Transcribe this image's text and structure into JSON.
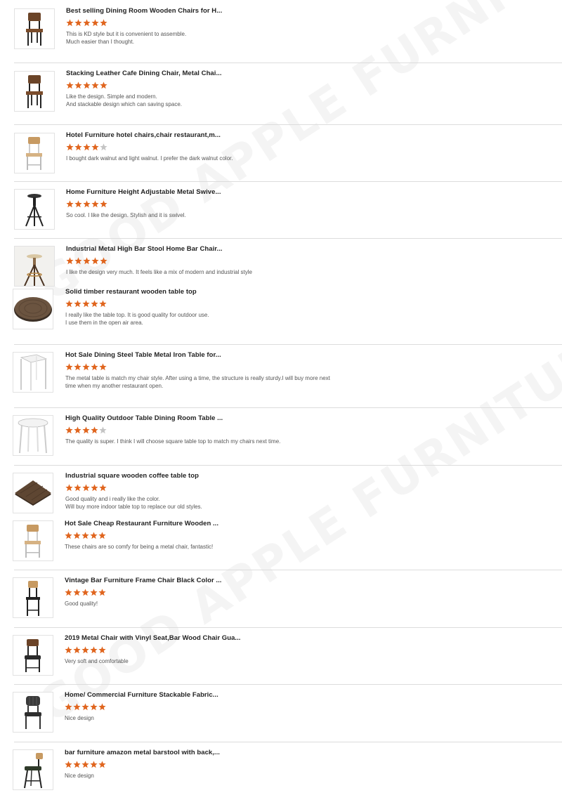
{
  "watermark": "GOOD APPLE FURNITURE",
  "colors": {
    "star_on": "#e0651e",
    "star_off": "#c4c4c4",
    "separator": "#dcdcdc"
  },
  "reviews": [
    {
      "title": "Best selling Dining Room Wooden Chairs for H...",
      "rating": 5,
      "comment": [
        "This is KD style but it is convenient to assemble.",
        "Much easier than I thought."
      ],
      "image": "chair-dark-wood-icon"
    },
    {
      "title": "Stacking Leather Cafe Dining Chair, Metal Chai...",
      "rating": 5,
      "comment": [
        "Like the design. Simple and modern.",
        "And stackable design which can saving space."
      ],
      "image": "chair-dark-wood-icon"
    },
    {
      "title": "Hotel Furniture hotel chairs,chair restaurant,m...",
      "rating": 4,
      "comment": [
        "I bought dark walnut and light walnut. I prefer the dark walnut color."
      ],
      "image": "chair-light-wood-icon"
    },
    {
      "title": "Home Furniture Height Adjustable Metal Swive...",
      "rating": 5,
      "comment": [
        "So cool. I like the design. Stylish and it is swivel."
      ],
      "image": "swivel-stool-icon"
    },
    {
      "title": "Industrial Metal High Bar Stool Home Bar Chair...",
      "rating": 5,
      "comment": [
        "I like the design very much. It feels like a mix of modern and industrial style"
      ],
      "image": "bar-stool-icon"
    },
    {
      "title": "Solid timber restaurant wooden table top",
      "rating": 5,
      "comment": [
        "I really like the table top. It is good quality for outdoor use.",
        "I use them in the open air area."
      ],
      "image": "round-table-top-icon"
    },
    {
      "title": "Hot Sale Dining Steel Table Metal Iron Table for...",
      "rating": 5,
      "comment": [
        "The metal table is match my chair style. After using a time, the structure is really sturdy.I will buy more next",
        "time when my another restaurant open."
      ],
      "image": "square-metal-table-icon"
    },
    {
      "title": "High Quality Outdoor Table Dining Room Table ...",
      "rating": 4,
      "comment": [
        "The quality is super. I think I will choose square table top to match my chairs next time."
      ],
      "image": "round-metal-table-icon"
    },
    {
      "title": "Industrial square wooden coffee table top",
      "rating": 5,
      "comment": [
        "Good quality and i really like the color.",
        "Will buy more indoor table top to replace our old styles."
      ],
      "image": "square-table-top-icon"
    },
    {
      "title": "Hot Sale Cheap Restaurant Furniture Wooden ...",
      "rating": 5,
      "comment": [
        "These chairs are so comfy for being a metal chair, fantastic!"
      ],
      "image": "chair-light-wood-icon"
    },
    {
      "title": "Vintage Bar Furniture Frame Chair Black Color ...",
      "rating": 5,
      "comment": [
        "Good quality!"
      ],
      "image": "bar-chair-icon"
    },
    {
      "title": "2019 Metal Chair with Vinyl Seat,Bar Wood Chair Gua...",
      "rating": 5,
      "comment": [
        "Very soft and comfortable"
      ],
      "image": "chair-dark-seat-icon"
    },
    {
      "title": "Home/ Commercial Furniture Stackable Fabric...",
      "rating": 5,
      "comment": [
        "Nice design"
      ],
      "image": "fabric-chair-icon"
    },
    {
      "title": "bar furniture amazon metal barstool with back,...",
      "rating": 5,
      "comment": [
        "Nice design"
      ],
      "image": "barstool-back-icon"
    }
  ]
}
